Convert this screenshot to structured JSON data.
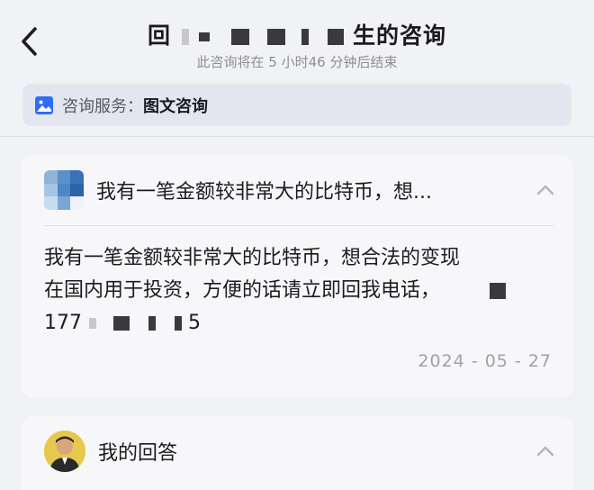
{
  "header": {
    "back_icon": "chevron-left-icon",
    "title_prefix": "回",
    "title_suffix": "生的咨询",
    "subtitle": "此咨询将在 5 小时46 分钟后结束"
  },
  "service": {
    "icon": "image-icon",
    "label": "咨询服务：",
    "value": "图文咨询"
  },
  "question": {
    "title": "我有一笔金额较非常大的比特币，想...",
    "line1": "我有一笔金额较非常大的比特币，想合法的变现",
    "line2": "在国内用于投资，方便的话请立即回我电话，",
    "line3_prefix": "177",
    "line3_suffix": "5",
    "date": "2024 - 05 - 27",
    "collapse_icon": "chevron-up-icon"
  },
  "answer": {
    "title": "我的回答",
    "collapse_icon": "chevron-up-icon"
  },
  "colors": {
    "background": "#f1f2f5",
    "card": "#f7f7f9",
    "pill": "#e4e6ef",
    "accent": "#2f6df6",
    "muted": "#a1a1a6"
  }
}
